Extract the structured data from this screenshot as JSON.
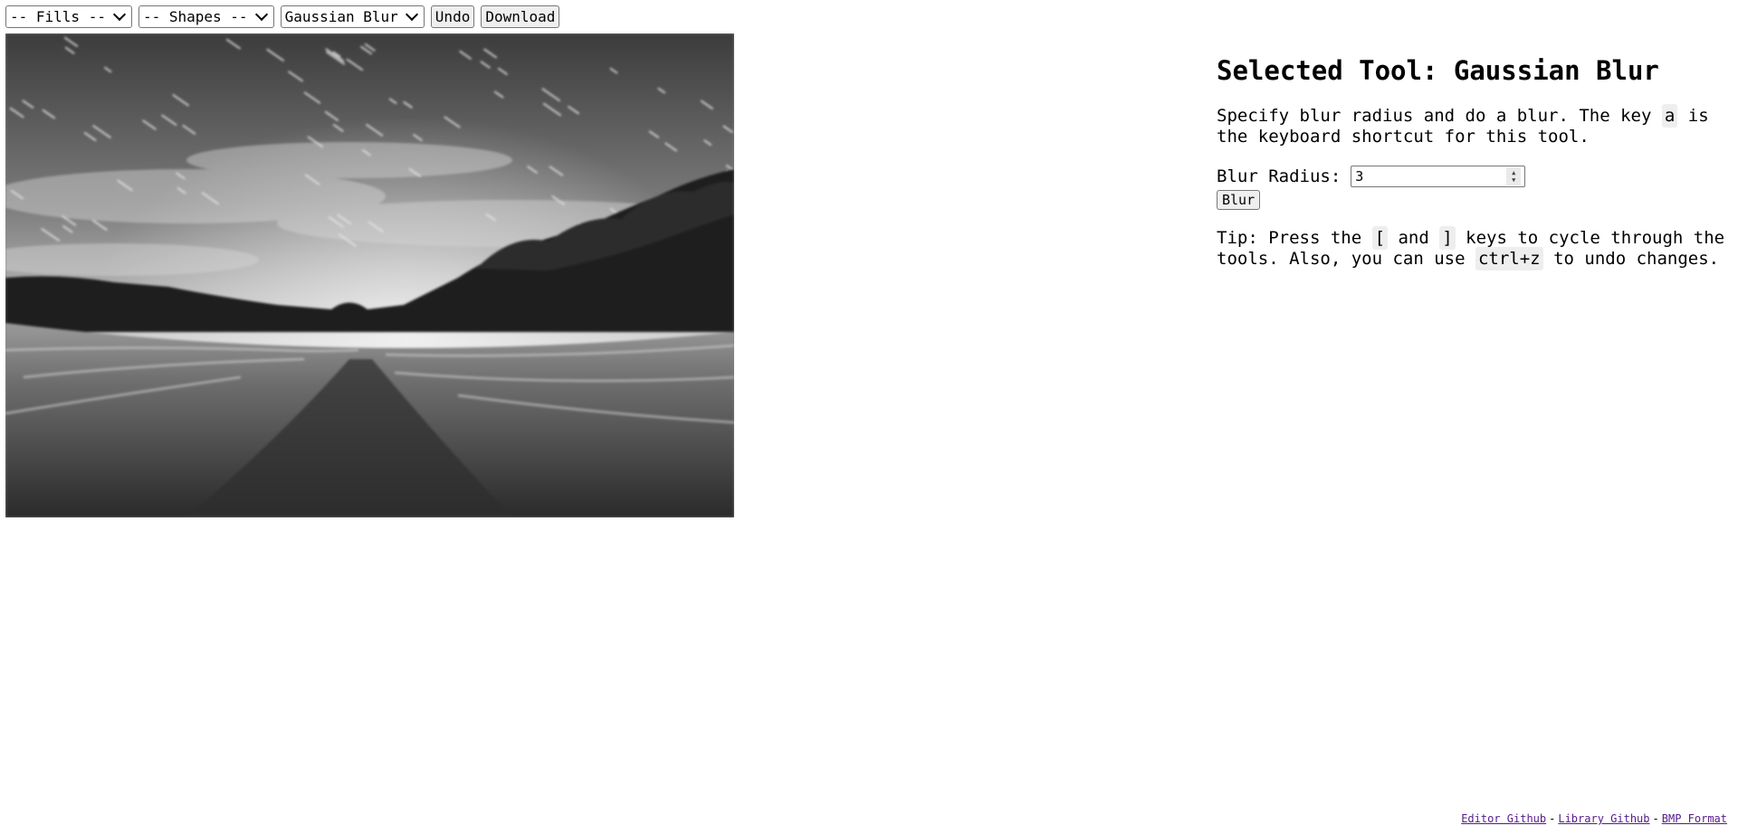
{
  "toolbar": {
    "fills_select": "-- Fills --",
    "shapes_select": "-- Shapes --",
    "tool_select": "Gaussian Blur",
    "undo_label": "Undo",
    "download_label": "Download"
  },
  "canvas": {
    "description_icon": "grayscale-landscape-photo"
  },
  "panel": {
    "title": "Selected Tool: Gaussian Blur",
    "desc_pre": "Specify blur radius and do a blur. The key ",
    "desc_key": "a",
    "desc_post": " is the keyboard shortcut for this tool.",
    "radius_label": "Blur Radius:",
    "radius_value": "3",
    "blur_button": "Blur",
    "tip_pre": "Tip: Press the ",
    "tip_key1": "[",
    "tip_and": " and ",
    "tip_key2": "]",
    "tip_mid": " keys to cycle through the tools. Also, you can use ",
    "tip_key3": "ctrl+z",
    "tip_post": " to undo changes."
  },
  "footer": {
    "link1": "Editor Github",
    "sep": "-",
    "link2": "Library Github",
    "link3": "BMP Format"
  }
}
